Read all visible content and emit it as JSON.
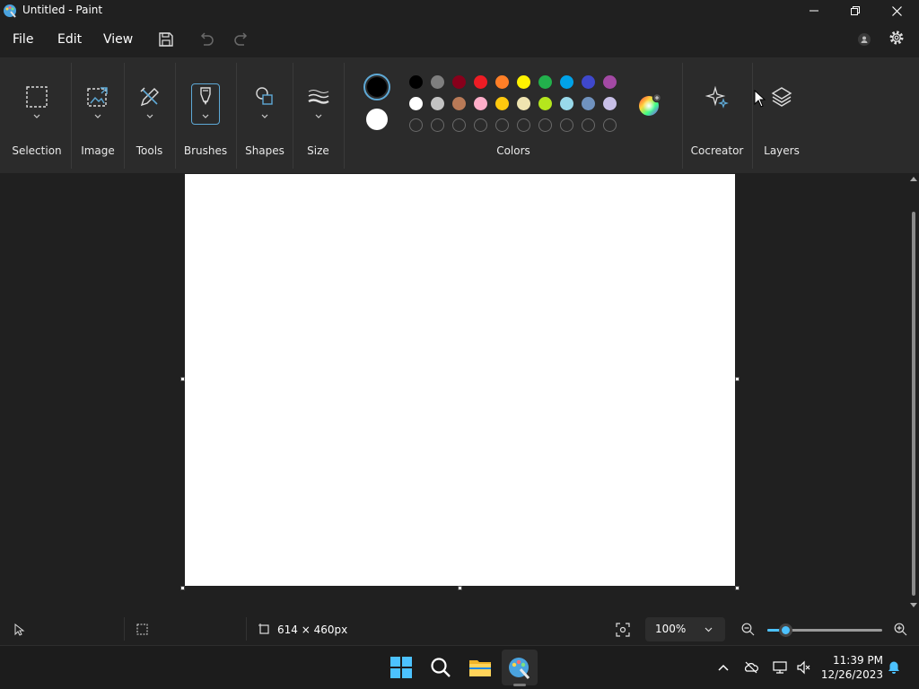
{
  "window": {
    "title": "Untitled - Paint"
  },
  "menu": {
    "file": "File",
    "edit": "Edit",
    "view": "View"
  },
  "ribbon": {
    "groups": {
      "selection": "Selection",
      "image": "Image",
      "tools": "Tools",
      "brushes": "Brushes",
      "shapes": "Shapes",
      "size": "Size",
      "colors": "Colors",
      "cocreator": "Cocreator",
      "layers": "Layers"
    },
    "current_colors": {
      "primary": "#000000",
      "secondary": "#ffffff"
    },
    "palette_row1": [
      "#000000",
      "#7f7f7f",
      "#88001b",
      "#ed1c24",
      "#ff7f27",
      "#fff200",
      "#22b14c",
      "#00a2e8",
      "#3f48cc",
      "#a349a4"
    ],
    "palette_row2": [
      "#ffffff",
      "#c3c3c3",
      "#b97a57",
      "#ffaec9",
      "#ffc90e",
      "#efe4b0",
      "#b5e61d",
      "#99d9ea",
      "#7092be",
      "#c8bfe7"
    ],
    "palette_row3_empty_slots": 10
  },
  "status": {
    "canvas_size": "614 × 460px",
    "zoom": "100%",
    "zoom_level": 0.16
  },
  "taskbar": {
    "time": "11:39 PM",
    "date": "12/26/2023"
  },
  "colors": {
    "accent": "#4cc2ff",
    "brush_outline": "#5ea9d6"
  }
}
